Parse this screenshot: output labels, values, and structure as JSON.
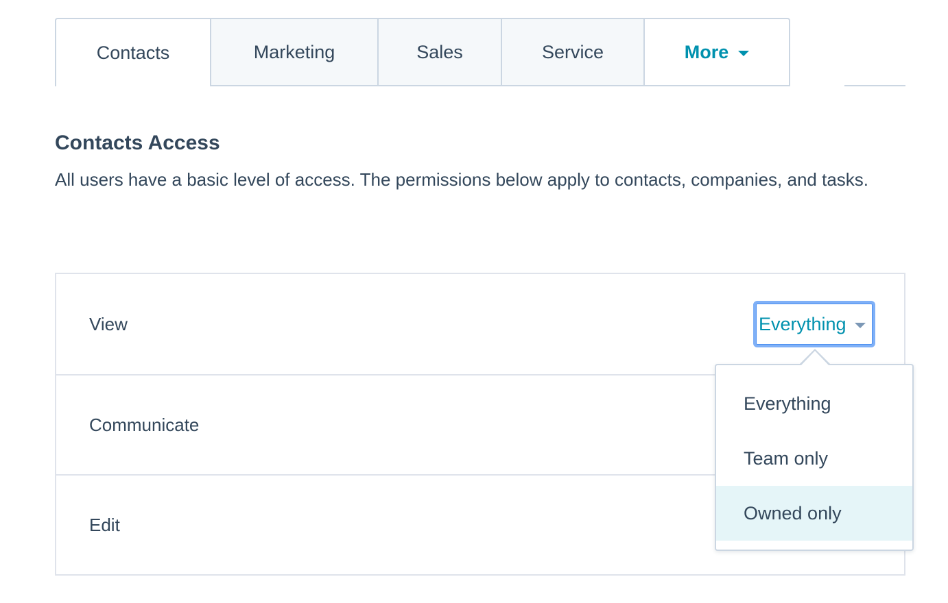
{
  "tabs": {
    "contacts": "Contacts",
    "marketing": "Marketing",
    "sales": "Sales",
    "service": "Service",
    "more": "More"
  },
  "section": {
    "title": "Contacts Access",
    "description": "All users have a basic level of access. The permissions below apply to contacts, companies, and tasks."
  },
  "permissions": {
    "view": "View",
    "communicate": "Communicate",
    "edit": "Edit"
  },
  "select": {
    "selected": "Everything"
  },
  "dropdown": {
    "options": [
      "Everything",
      "Team only",
      "Owned only"
    ],
    "highlighted": "Owned only"
  },
  "colors": {
    "accent": "#0091ae",
    "text": "#33475b",
    "border": "#cbd6e2",
    "focus_ring": "#7fb0f7",
    "highlight": "#e5f5f8"
  }
}
